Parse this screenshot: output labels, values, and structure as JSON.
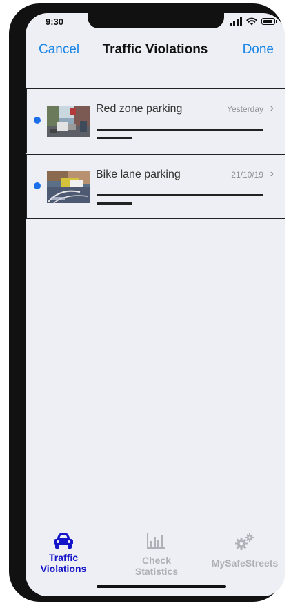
{
  "status_bar": {
    "time": "9:30"
  },
  "nav": {
    "cancel_label": "Cancel",
    "title": "Traffic Violations",
    "done_label": "Done"
  },
  "violations": [
    {
      "title": "Red zone parking",
      "date": "Yesterday",
      "unread": true,
      "thumbnail": "street-parking-photo"
    },
    {
      "title": "Bike lane parking",
      "date": "21/10/19",
      "unread": true,
      "thumbnail": "bike-lane-photo"
    }
  ],
  "tabbar": {
    "tabs": [
      {
        "label_line1": "Traffic",
        "label_line2": "Violations",
        "icon": "car-icon",
        "active": true
      },
      {
        "label_line1": "Check",
        "label_line2": "Statistics",
        "icon": "bar-chart-icon",
        "active": false
      },
      {
        "label_line1": "MySafeStreets",
        "label_line2": "",
        "icon": "gears-icon",
        "active": false
      }
    ]
  },
  "colors": {
    "accent": "#1a86e5",
    "active_tab": "#1414c8",
    "inactive_tab": "#b0b0b8",
    "unread_dot": "#1a6fe8",
    "background": "#eeeff4"
  }
}
